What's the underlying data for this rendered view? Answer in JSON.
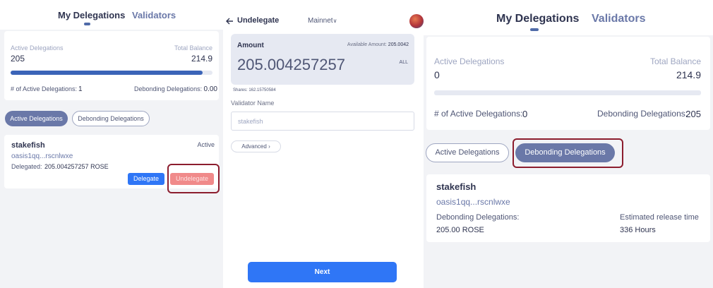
{
  "left": {
    "tabs": [
      "My Delegations",
      "Validators"
    ],
    "summary": {
      "active_label": "Active Delegations",
      "active_value": "205",
      "total_label": "Total Balance",
      "total_value": "214.9",
      "progress_fraction": 0.95,
      "count_label": "# of Active Delegations:",
      "count_value": "1",
      "debonding_label": "Debonding Delegations:",
      "debonding_value": "0.00"
    },
    "filters": {
      "active": "Active Delegations",
      "debonding": "Debonding Delegations"
    },
    "delegation": {
      "name": "stakefish",
      "status": "Active",
      "address": "oasis1qq...rscnlwxe",
      "delegated_label": "Delegated:",
      "delegated_value": "205.004257257 ROSE",
      "delegate_btn": "Delegate",
      "undelegate_btn": "Undelegate"
    }
  },
  "middle": {
    "back_icon": "arrow-left-icon",
    "title": "Undelegate",
    "network": "Mainnet",
    "amount_label": "Amount",
    "available_label": "Available Amount:",
    "available_value": "205.0042",
    "amount_value": "205.004257257",
    "all_label": "ALL",
    "shares": "Shares: 162.15750584",
    "validator_label": "Validator Name",
    "validator_placeholder": "stakefish",
    "advanced_label": "Advanced",
    "next_label": "Next",
    "accent": "#2f76f6"
  },
  "right": {
    "tabs": [
      "My Delegations",
      "Validators"
    ],
    "summary": {
      "active_label": "Active Delegations",
      "active_value": "0",
      "total_label": "Total Balance",
      "total_value": "214.9",
      "count_label": "# of Active Delegations:",
      "count_value": "0",
      "debonding_label": "Debonding Delegations:",
      "debonding_value": "205"
    },
    "filters": {
      "active": "Active Delegations",
      "debonding": "Debonding Delegations"
    },
    "delegation": {
      "name": "stakefish",
      "address": "oasis1qq...rscnlwxe",
      "debonding_label": "Debonding Delegations:",
      "debonding_value": "205.00 ROSE",
      "release_label": "Estimated release time",
      "release_value": "336 Hours"
    }
  }
}
